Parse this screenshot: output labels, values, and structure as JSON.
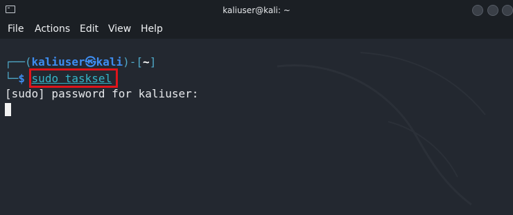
{
  "window": {
    "title": "kaliuser@kali: ~",
    "icon": "terminal-icon"
  },
  "menu": {
    "items": [
      "File",
      "Actions",
      "Edit",
      "View",
      "Help"
    ]
  },
  "terminal": {
    "prompt": {
      "top_open": "┌──(",
      "user_host": "kaliuser㉿kali",
      "mid": ")-[",
      "dir": "~",
      "top_close": "]",
      "bottom": "└─",
      "symbol": "$"
    },
    "command": "sudo tasksel",
    "output": "[sudo] password for kaliuser:"
  },
  "colors": {
    "background": "#232830",
    "highlight_box": "#e0141b",
    "prompt_user": "#3e8df0",
    "command": "#34b6c9"
  }
}
